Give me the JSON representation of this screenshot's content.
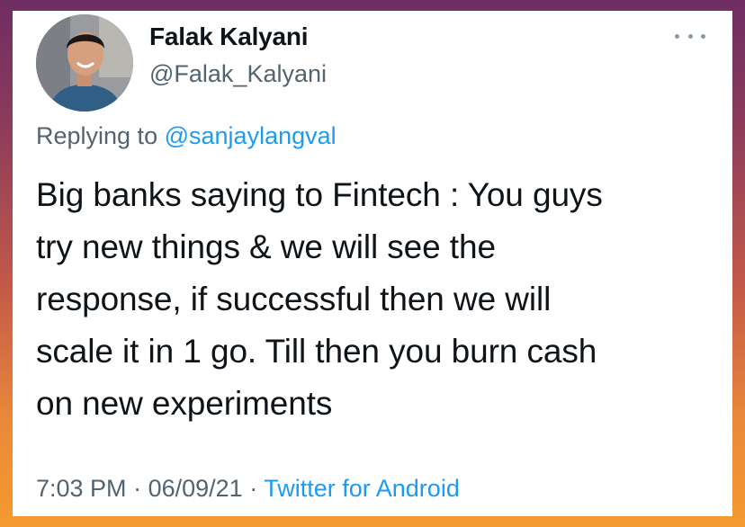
{
  "tweet": {
    "display_name": "Falak Kalyani",
    "handle": "@Falak_Kalyani",
    "replying_prefix": "Replying to",
    "replying_to": "@sanjaylangval",
    "text_lines": [
      "Big banks saying to Fintech : You guys",
      "try new things & we will see the",
      "response, if successful then we will",
      "scale it in 1 go. Till then you burn cash",
      "on new experiments"
    ],
    "time": "7:03 PM",
    "separator": "·",
    "date": "06/09/21",
    "source": "Twitter for Android"
  },
  "icons": {
    "more": "more-horizontal-icon",
    "avatar": "avatar"
  },
  "colors": {
    "primary_text": "#0f1419",
    "secondary_text": "#536471",
    "link": "#1d9bf0",
    "card_background": "#ffffff"
  }
}
